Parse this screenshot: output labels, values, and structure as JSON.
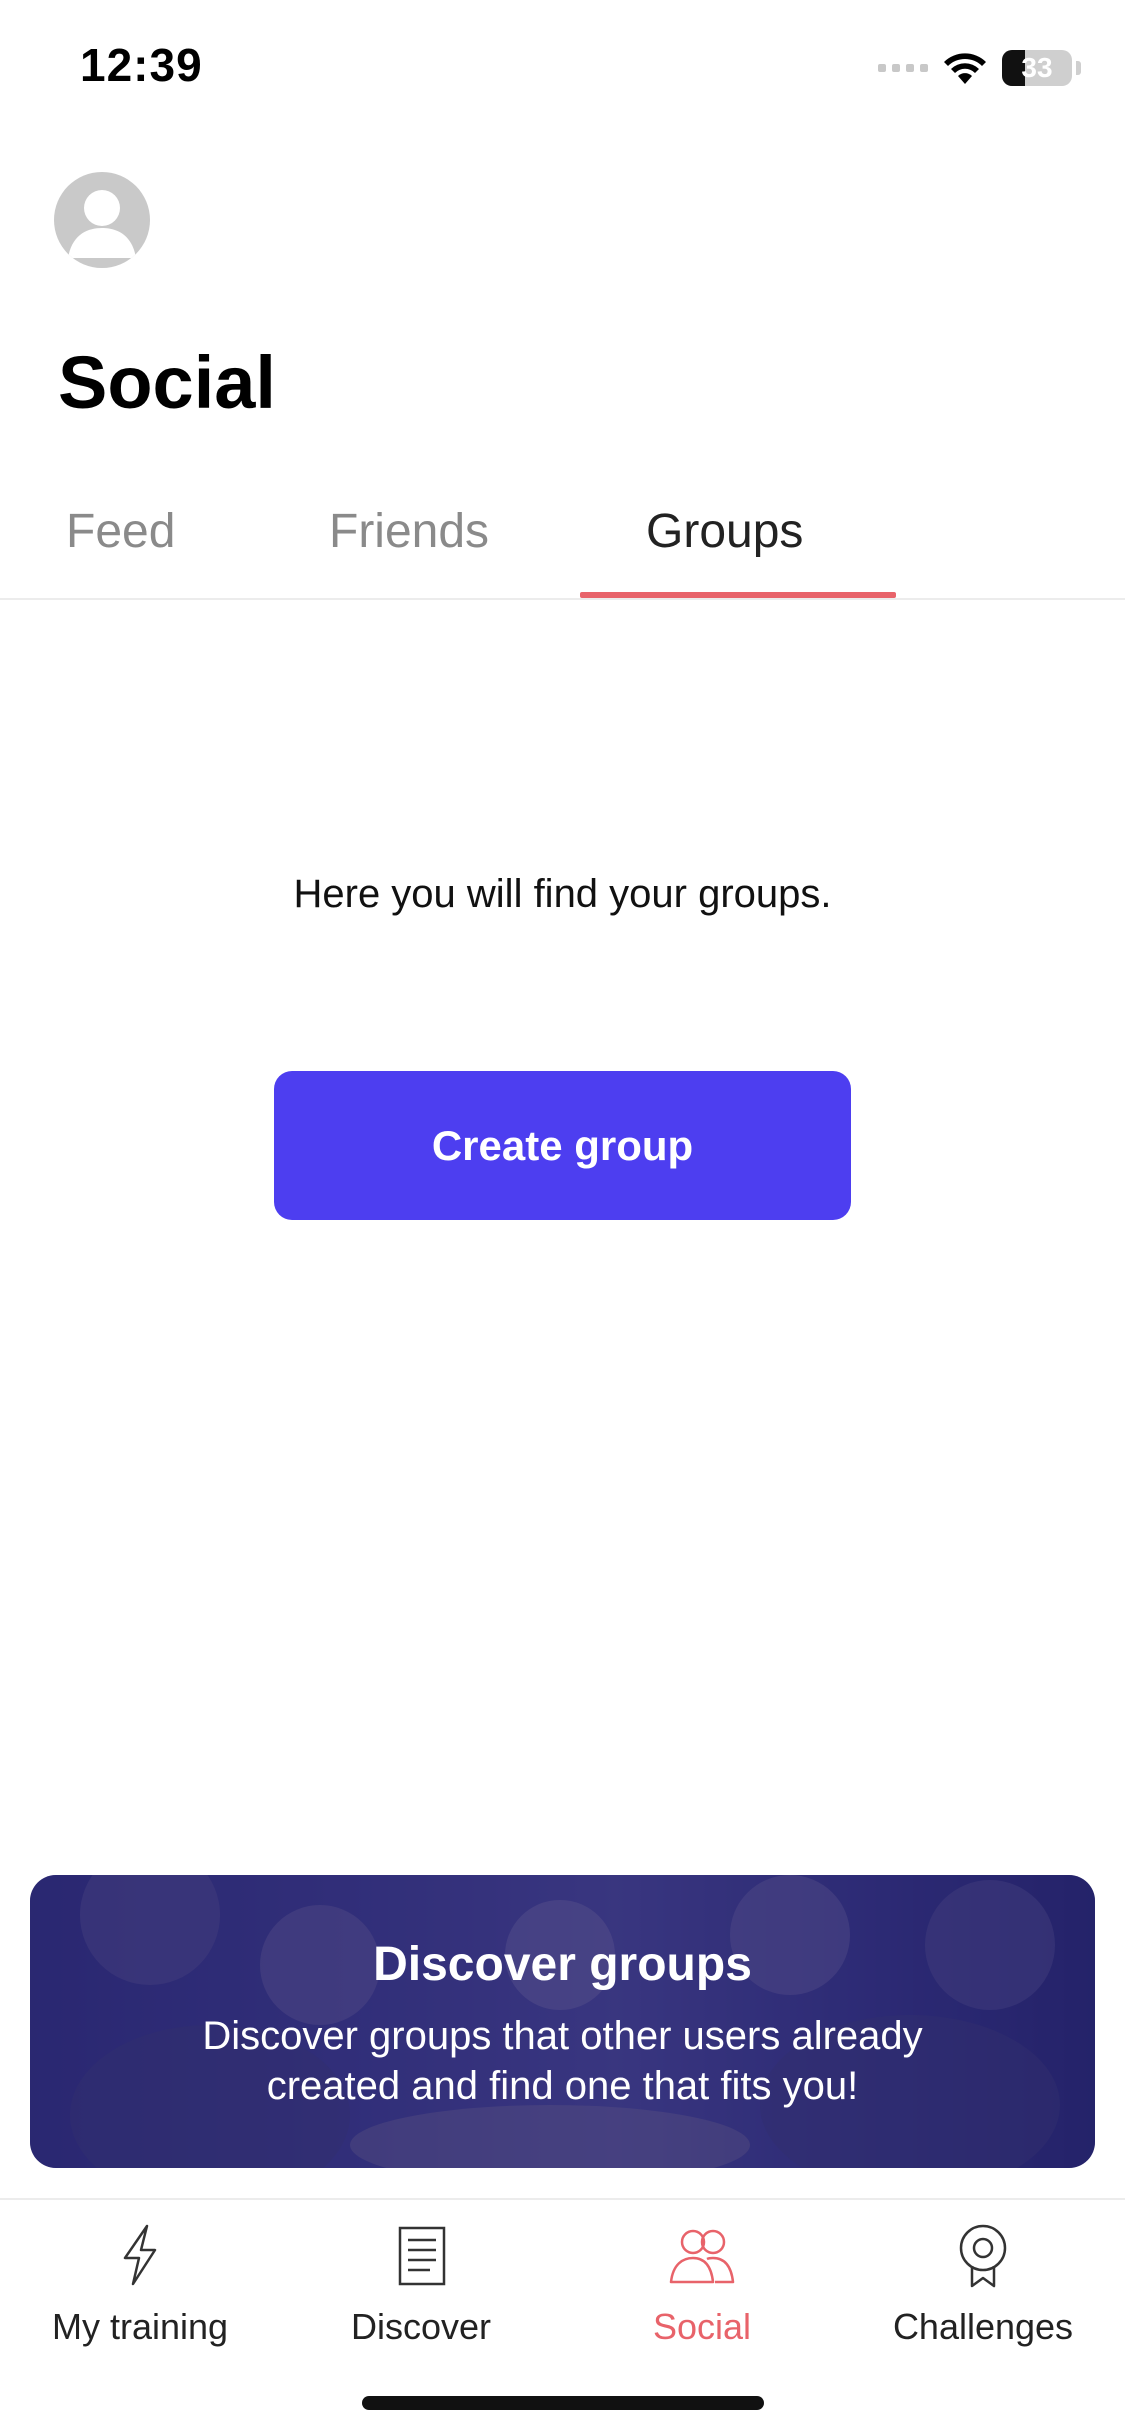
{
  "status_bar": {
    "time": "12:39",
    "battery": "33"
  },
  "header": {
    "title": "Social"
  },
  "tabs": [
    {
      "label": "Feed",
      "active": false
    },
    {
      "label": "Friends",
      "active": false
    },
    {
      "label": "Groups",
      "active": true
    }
  ],
  "empty_state": {
    "message": "Here you will find your groups.",
    "button_label": "Create group"
  },
  "banner": {
    "title": "Discover groups",
    "text": "Discover groups that other users already created and find one that fits you!"
  },
  "bottom_nav": [
    {
      "label": "My training",
      "icon": "bolt-icon",
      "active": false
    },
    {
      "label": "Discover",
      "icon": "document-icon",
      "active": false
    },
    {
      "label": "Social",
      "icon": "people-icon",
      "active": true
    },
    {
      "label": "Challenges",
      "icon": "award-icon",
      "active": false
    }
  ],
  "colors": {
    "accent": "#e8636a",
    "primary_button": "#4d3ef0",
    "banner_overlay": "#1e1e6e"
  }
}
